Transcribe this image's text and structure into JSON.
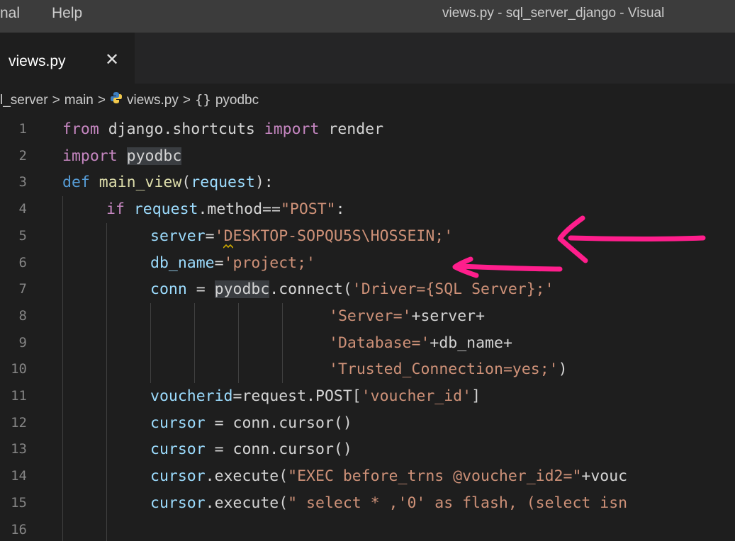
{
  "menu": {
    "items": [
      "nal",
      "Help"
    ]
  },
  "window": {
    "title": "views.py - sql_server_django - Visual"
  },
  "tab": {
    "label": "views.py",
    "close": "✕"
  },
  "breadcrumb": {
    "parts": [
      "l_server",
      "main",
      "views.py",
      "pyodbc"
    ],
    "separator": ">",
    "namespace_glyph": "{}"
  },
  "editor": {
    "line_numbers": [
      "1",
      "2",
      "3",
      "4",
      "5",
      "6",
      "7",
      "8",
      "9",
      "10",
      "11",
      "12",
      "13",
      "14",
      "15",
      "16"
    ],
    "lines": [
      [
        {
          "t": "from",
          "c": "kw"
        },
        {
          "t": " django.shortcuts ",
          "c": "pl"
        },
        {
          "t": "import",
          "c": "kw"
        },
        {
          "t": " render",
          "c": "pl"
        }
      ],
      [
        {
          "t": "import",
          "c": "kw"
        },
        {
          "t": " ",
          "c": "pl"
        },
        {
          "t": "pyodbc",
          "c": "pl hl"
        }
      ],
      [
        {
          "t": "def",
          "c": "kw2"
        },
        {
          "t": " ",
          "c": "pl"
        },
        {
          "t": "main_view",
          "c": "fn"
        },
        {
          "t": "(",
          "c": "pl"
        },
        {
          "t": "request",
          "c": "var"
        },
        {
          "t": "):",
          "c": "pl"
        }
      ],
      [
        {
          "t": "if",
          "c": "kw"
        },
        {
          "t": " ",
          "c": "pl"
        },
        {
          "t": "request",
          "c": "var"
        },
        {
          "t": ".method==",
          "c": "pl"
        },
        {
          "t": "\"POST\"",
          "c": "str"
        },
        {
          "t": ":",
          "c": "pl"
        }
      ],
      [
        {
          "t": "server",
          "c": "var"
        },
        {
          "t": "=",
          "c": "pl"
        },
        {
          "t": "'DESKTOP-SOPQU5S\\HOSSEIN;'",
          "c": "str"
        }
      ],
      [
        {
          "t": "db_name",
          "c": "var"
        },
        {
          "t": "=",
          "c": "pl"
        },
        {
          "t": "'project;'",
          "c": "str"
        }
      ],
      [
        {
          "t": "conn",
          "c": "var"
        },
        {
          "t": " = ",
          "c": "pl"
        },
        {
          "t": "pyodbc",
          "c": "pl hl"
        },
        {
          "t": ".connect(",
          "c": "pl"
        },
        {
          "t": "'Driver={SQL Server};'",
          "c": "str"
        }
      ],
      [
        {
          "t": "'Server='",
          "c": "str"
        },
        {
          "t": "+server+",
          "c": "pl"
        }
      ],
      [
        {
          "t": "'Database='",
          "c": "str"
        },
        {
          "t": "+db_name+",
          "c": "pl"
        }
      ],
      [
        {
          "t": "'Trusted_Connection=yes;'",
          "c": "str"
        },
        {
          "t": ")",
          "c": "pl"
        }
      ],
      [
        {
          "t": "voucherid",
          "c": "var"
        },
        {
          "t": "=request.POST[",
          "c": "pl"
        },
        {
          "t": "'voucher_id'",
          "c": "str"
        },
        {
          "t": "]",
          "c": "pl"
        }
      ],
      [
        {
          "t": "cursor",
          "c": "var"
        },
        {
          "t": " = conn.cursor()",
          "c": "pl"
        }
      ],
      [
        {
          "t": "cursor",
          "c": "var"
        },
        {
          "t": " = conn.cursor()",
          "c": "pl"
        }
      ],
      [
        {
          "t": "cursor",
          "c": "var"
        },
        {
          "t": ".execute(",
          "c": "pl"
        },
        {
          "t": "\"EXEC before_trns @voucher_id2=\"",
          "c": "str"
        },
        {
          "t": "+vouc",
          "c": "pl"
        }
      ],
      [
        {
          "t": "cursor",
          "c": "var"
        },
        {
          "t": ".execute(",
          "c": "pl"
        },
        {
          "t": "\" select * ,'0' as flash, (select isn",
          "c": "str"
        }
      ],
      []
    ]
  },
  "colors": {
    "annotation_arrow": "#ff1e8c"
  }
}
